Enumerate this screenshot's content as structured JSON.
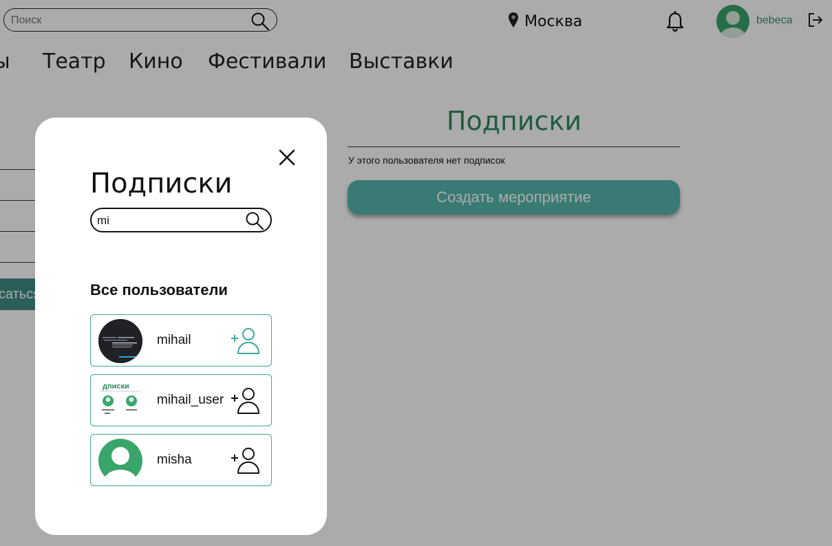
{
  "header": {
    "search_placeholder": "Поиск",
    "city": "Москва",
    "username": "bebeca"
  },
  "nav": {
    "items": [
      "ы",
      "Театр",
      "Кино",
      "Фестивали",
      "Выставки"
    ]
  },
  "left_panel": {
    "button_label": "саться"
  },
  "main": {
    "title": "Подписки",
    "empty_text": "У этого пользователя нет подписок",
    "create_button": "Создать мероприятие"
  },
  "modal": {
    "title": "Подписки",
    "search_value": "mi",
    "section_title": "Все пользователи",
    "users": [
      {
        "name": "mihail",
        "avatar": "dark-screenshot",
        "add_color": "#3aa79a"
      },
      {
        "name": "mihail_user",
        "avatar": "page-screenshot",
        "add_color": "#111111",
        "thumb_text": "дписки"
      },
      {
        "name": "misha",
        "avatar": "default-green",
        "add_color": "#111111"
      }
    ]
  },
  "colors": {
    "accent_green": "#2e8a5d",
    "button_teal": "#56b8ae",
    "card_border": "#3aa79a",
    "avatar_green": "#3aa56b"
  }
}
